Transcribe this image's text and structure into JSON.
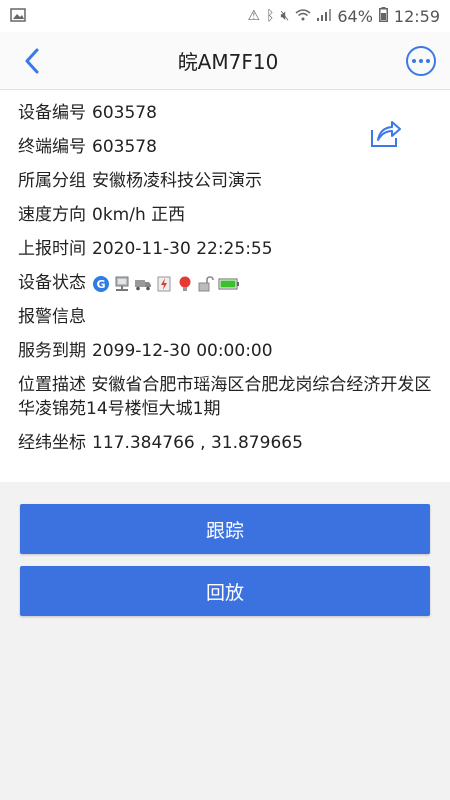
{
  "status_bar": {
    "battery": "64%",
    "time": "12:59"
  },
  "header": {
    "title": "皖AM7F10"
  },
  "info": {
    "device_no_label": "设备编号",
    "device_no": "603578",
    "terminal_no_label": "终端编号",
    "terminal_no": "603578",
    "group_label": "所属分组",
    "group": "安徽杨凌科技公司演示",
    "speed_label": "速度方向",
    "speed": "0km/h 正西",
    "report_time_label": "上报时间",
    "report_time": "2020-11-30 22:25:55",
    "state_label": "设备状态",
    "state_icons": [
      "gps-icon",
      "network-icon",
      "truck-icon",
      "power-icon",
      "bulb-icon",
      "lock-icon",
      "battery-icon"
    ],
    "alarm_label": "报警信息",
    "alarm": "",
    "service_label": "服务到期",
    "service": "2099-12-30 00:00:00",
    "location_label": "位置描述",
    "location": "安徽省合肥市瑶海区合肥龙岗综合经济开发区华凌锦苑14号楼恒大城1期",
    "coords_label": "经纬坐标",
    "coords": "117.384766 , 31.879665"
  },
  "actions": {
    "track": "跟踪",
    "playback": "回放"
  },
  "colors": {
    "accent": "#3b72e0",
    "icon_blue": "#3a79e8"
  }
}
